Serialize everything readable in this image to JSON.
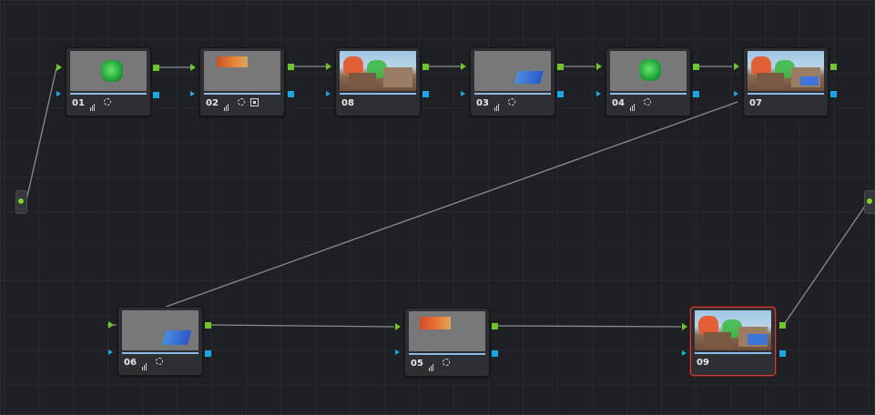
{
  "colors": {
    "background": "#1f2024",
    "node": "#2e2f33",
    "connection": "#8a8c90",
    "rgb_port": "#6fc62a",
    "key_port": "#18a8e6",
    "selected_outline": "#d23b35"
  },
  "nodes": [
    {
      "id": "01",
      "label": "01",
      "thumb": "green-mask",
      "tools": [
        "curves-icon",
        "window-icon"
      ]
    },
    {
      "id": "02",
      "label": "02",
      "thumb": "orange-mask",
      "tools": [
        "curves-icon",
        "window-icon",
        "key-icon"
      ]
    },
    {
      "id": "08",
      "label": "08",
      "thumb": "full-color",
      "tools": []
    },
    {
      "id": "03",
      "label": "03",
      "thumb": "blue-mask",
      "tools": [
        "curves-icon",
        "window-icon"
      ]
    },
    {
      "id": "04",
      "label": "04",
      "thumb": "green-mask",
      "tools": [
        "curves-icon",
        "window-icon"
      ]
    },
    {
      "id": "07",
      "label": "07",
      "thumb": "full-color",
      "tools": []
    },
    {
      "id": "06",
      "label": "06",
      "thumb": "blue-mask",
      "tools": [
        "curves-icon",
        "window-icon"
      ]
    },
    {
      "id": "05",
      "label": "05",
      "thumb": "orange-mask",
      "tools": [
        "curves-icon",
        "window-icon"
      ]
    },
    {
      "id": "09",
      "label": "09",
      "thumb": "full-color",
      "tools": [],
      "selected": true
    }
  ],
  "connections": [
    [
      "source",
      "01"
    ],
    [
      "01",
      "02"
    ],
    [
      "02",
      "08"
    ],
    [
      "08",
      "03"
    ],
    [
      "03",
      "04"
    ],
    [
      "04",
      "07"
    ],
    [
      "07",
      "06"
    ],
    [
      "06",
      "05"
    ],
    [
      "05",
      "09"
    ],
    [
      "09",
      "output"
    ]
  ]
}
